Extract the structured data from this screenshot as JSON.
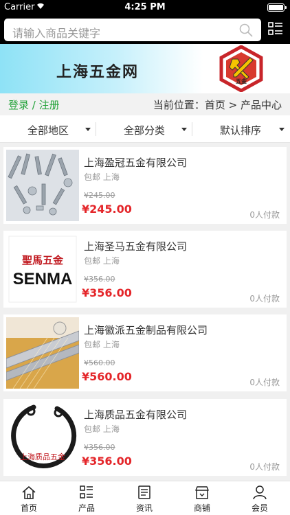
{
  "status": {
    "carrier": "Carrier",
    "time": "4:25 PM"
  },
  "search": {
    "placeholder": "请输入商品关键字"
  },
  "banner": {
    "brand": "上海五金网",
    "logo_text": "五金"
  },
  "location": {
    "login": "登录 / 注册",
    "breadcrumb": "当前位置：首页 > 产品中心"
  },
  "filters": [
    "全部地区",
    "全部分类",
    "默认排序"
  ],
  "currency": "¥",
  "products": [
    {
      "title": "上海盈冠五金有限公司",
      "meta": "包邮 上海",
      "old_price": "¥245.00",
      "price": "¥245.00",
      "paid": "0人付款",
      "image": "screws-bolts"
    },
    {
      "title": "上海圣马五金有限公司",
      "meta": "包邮 上海",
      "old_price": "¥356.00",
      "price": "¥356.00",
      "paid": "0人付款",
      "image": "senma-logo",
      "image_text_cn": "聖馬五金",
      "image_text_en": "SENMA"
    },
    {
      "title": "上海徽派五金制品有限公司",
      "meta": "包邮 上海",
      "old_price": "¥560.00",
      "price": "¥560.00",
      "paid": "0人付款",
      "image": "drawer-slides"
    },
    {
      "title": "上海质品五金有限公司",
      "meta": "包邮 上海",
      "old_price": "¥356.00",
      "price": "¥356.00",
      "paid": "0人付款",
      "image": "retaining-ring",
      "image_text_cn": "上海质品五金"
    }
  ],
  "tabs": [
    {
      "label": "首页",
      "icon": "home-icon"
    },
    {
      "label": "产品",
      "icon": "list-icon"
    },
    {
      "label": "资讯",
      "icon": "news-icon"
    },
    {
      "label": "商铺",
      "icon": "store-icon"
    },
    {
      "label": "会员",
      "icon": "user-icon"
    }
  ]
}
